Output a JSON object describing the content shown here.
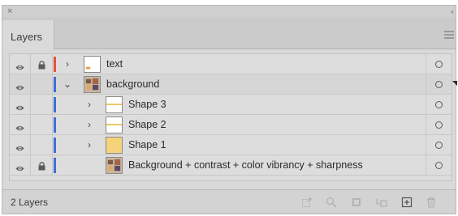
{
  "panel": {
    "title": "Layers",
    "close_glyph": "×",
    "collapse_glyph": "‹‹",
    "menu_icon": "hamburger-menu-icon"
  },
  "layers": [
    {
      "name": "text",
      "visible": true,
      "locked": true,
      "expanded": false,
      "indent": 0,
      "color": "#e8523c",
      "thumb": "text-thumb",
      "has_children": true
    },
    {
      "name": "background",
      "visible": true,
      "locked": false,
      "expanded": true,
      "indent": 0,
      "color": "#3d6fd8",
      "thumb": "image-thumb",
      "has_children": true,
      "selected": true
    },
    {
      "name": "Shape 3",
      "visible": true,
      "locked": false,
      "expanded": false,
      "indent": 1,
      "color": "#3d6fd8",
      "thumb": "shape-line-thumb",
      "has_children": true
    },
    {
      "name": "Shape 2",
      "visible": true,
      "locked": false,
      "expanded": false,
      "indent": 1,
      "color": "#3d6fd8",
      "thumb": "shape-line-thumb",
      "has_children": true
    },
    {
      "name": "Shape 1",
      "visible": true,
      "locked": false,
      "expanded": false,
      "indent": 1,
      "color": "#3d6fd8",
      "thumb": "shape-fill-thumb",
      "has_children": true
    },
    {
      "name": "Background + contrast + color vibrancy + sharpness",
      "visible": true,
      "locked": true,
      "expanded": false,
      "indent": 1,
      "color": "#3d6fd8",
      "thumb": "image-thumb",
      "has_children": false
    }
  ],
  "footer": {
    "count_label": "2 Layers",
    "icons": [
      "export-icon",
      "search-icon",
      "clip-icon",
      "new-sublayer-icon",
      "new-layer-icon",
      "trash-icon"
    ]
  }
}
